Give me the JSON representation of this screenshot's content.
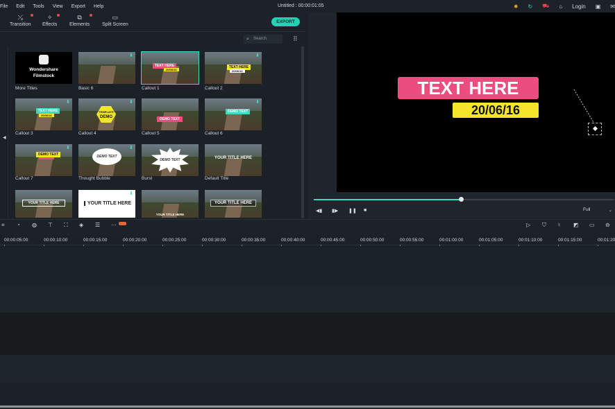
{
  "menu": [
    "File",
    "Edit",
    "Tools",
    "View",
    "Export",
    "Help"
  ],
  "window_title": "Untitled : 00:00:01:05",
  "topright": {
    "login": "Login"
  },
  "toolbar": {
    "transition": "Transition",
    "effects": "Effects",
    "elements": "Elements",
    "split_screen": "Split Screen",
    "export": "EXPORT"
  },
  "search": {
    "placeholder": "Search"
  },
  "titles": [
    {
      "label": "More Titles",
      "t1": "Wondershare",
      "t2": "Filmstock"
    },
    {
      "label": "Basic 6"
    },
    {
      "label": "Callout 1",
      "t1": "TEXT HERE",
      "t2": "20/06/16"
    },
    {
      "label": "Callout 2",
      "t1": "TEXT HERE",
      "t2": "20/06/16"
    },
    {
      "label": "Callout 3",
      "t1": "TEXT HERE",
      "t2": "20/06/16"
    },
    {
      "label": "Callout 4",
      "t1": "TEMPLATE",
      "t2": "DEMO"
    },
    {
      "label": "Callout 5",
      "t1": "DEMO TEXT"
    },
    {
      "label": "Callout 6",
      "t1": "DEMO TEXT"
    },
    {
      "label": "Callout 7",
      "t1": "DEMO TEXT"
    },
    {
      "label": "Thought Bubble",
      "t1": "DEMO TEXT"
    },
    {
      "label": "Burst",
      "t1": "DEMO TEXT"
    },
    {
      "label": "Default Title",
      "t1": "YOUR TITLE HERE"
    },
    {
      "label": "",
      "t1": "YOUR TITLE HERE"
    },
    {
      "label": "",
      "t1": "YOUR TITLE HERE"
    },
    {
      "label": "",
      "t1": "YOUR TITLE HERE"
    },
    {
      "label": "",
      "t1": "YOUR TITLE HERE"
    }
  ],
  "preview": {
    "title": "TEXT HERE",
    "date": "20/06/16",
    "quality": "Full",
    "progress": 0.49
  },
  "ruler": [
    "00:00:05:00",
    "00:00:10:00",
    "00:00:15:00",
    "00:00:20:00",
    "00:00:25:00",
    "00:00:30:00",
    "00:00:35:00",
    "00:00:40:00",
    "00:00:45:00",
    "00:00:50:00",
    "00:00:55:00",
    "00:01:00:00",
    "00:01:05:00",
    "00:01:10:00",
    "00:01:15:00",
    "00:01:20"
  ],
  "colors": {
    "accent": "#3fd8c0",
    "callout_pink": "#ec4d7f",
    "callout_yellow": "#f3e52b",
    "notification": "#e5484d"
  }
}
